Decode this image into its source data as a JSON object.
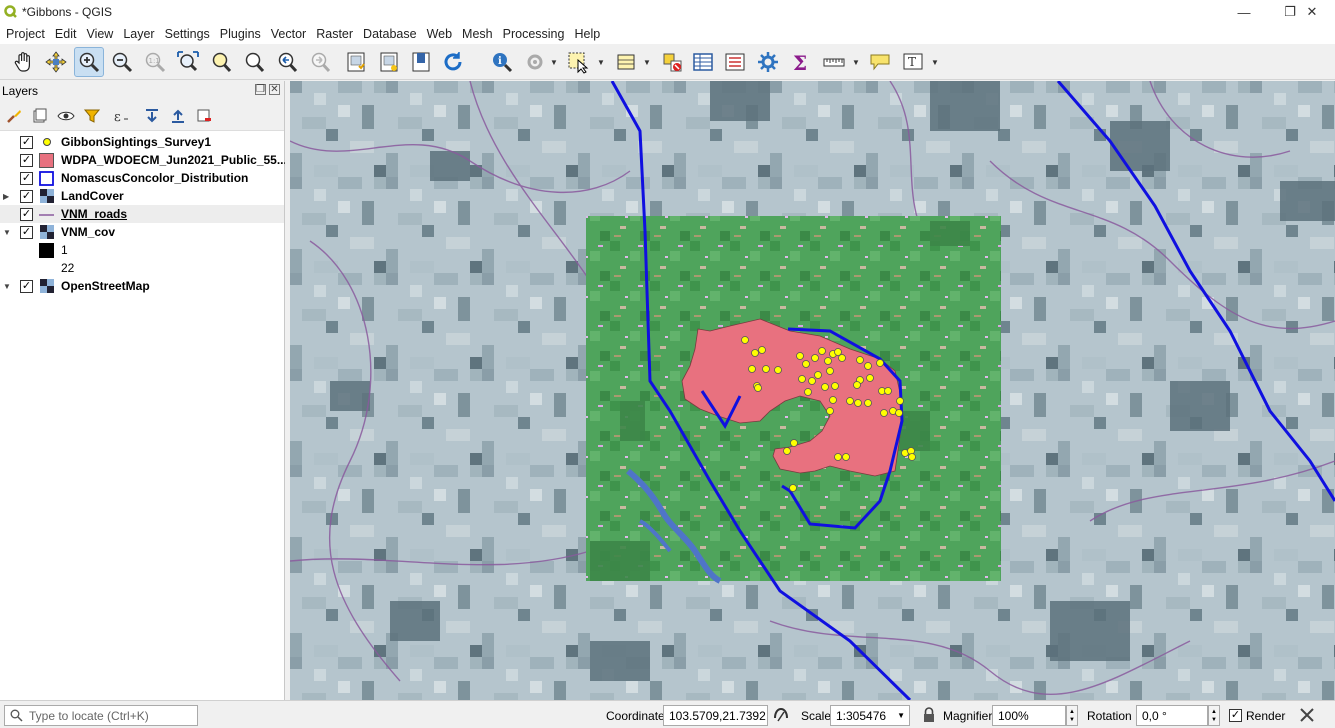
{
  "window": {
    "title": "*Gibbons - QGIS",
    "controls": [
      "minimize-icon",
      "restore-icon",
      "close-icon"
    ]
  },
  "menu": [
    "Project",
    "Edit",
    "View",
    "Layer",
    "Settings",
    "Plugins",
    "Vector",
    "Raster",
    "Database",
    "Web",
    "Mesh",
    "Processing",
    "Help"
  ],
  "toolbar": {
    "active_tool": "zoom-in-icon",
    "icons": [
      "pan-hand-icon",
      "pan-to-selection-icon",
      "zoom-in-icon",
      "zoom-out-icon",
      "zoom-native-icon",
      "zoom-full-icon",
      "zoom-to-selection-icon",
      "zoom-to-layer-icon",
      "zoom-last-icon",
      "zoom-next-icon",
      "new-bookmark-icon",
      "show-bookmarks-icon",
      "new-map-view-icon",
      "refresh-icon",
      "identify-icon",
      "action-icon",
      "select-features-icon",
      "select-by-value-icon",
      "deselect-icon",
      "attribute-table-icon",
      "field-calculator-icon",
      "toolbox-icon",
      "statistics-sigma-icon",
      "measure-icon",
      "map-tips-icon",
      "text-annotation-icon"
    ]
  },
  "layers_panel": {
    "title": "Layers",
    "items": [
      {
        "name": "GibbonSightings_Survey1",
        "checked": true,
        "symbol": "yellow-point-icon",
        "bold": true,
        "expander": ""
      },
      {
        "name": "WDPA_WDOECM_Jun2021_Public_55...",
        "checked": true,
        "symbol": "pink-polygon-icon",
        "bold": true,
        "expander": ""
      },
      {
        "name": "NomascusConcolor_Distribution",
        "checked": true,
        "symbol": "blue-outline-polygon-icon",
        "bold": true,
        "expander": ""
      },
      {
        "name": "LandCover",
        "checked": true,
        "symbol": "raster-icon",
        "bold": true,
        "expander": "collapsed"
      },
      {
        "name": "VNM_roads",
        "checked": true,
        "symbol": "purple-line-icon",
        "bold": true,
        "expander": "",
        "selected": true
      },
      {
        "name": "VNM_cov",
        "checked": true,
        "symbol": "raster-icon",
        "bold": true,
        "expander": "expanded"
      },
      {
        "name": "1",
        "checked": null,
        "symbol": "black-swatch-icon",
        "bold": false,
        "expander": ""
      },
      {
        "name": "22",
        "checked": null,
        "symbol": "",
        "bold": false,
        "expander": ""
      },
      {
        "name": "OpenStreetMap",
        "checked": true,
        "symbol": "raster-icon",
        "bold": true,
        "expander": "expanded"
      }
    ]
  },
  "status": {
    "locate_placeholder": "Type to locate (Ctrl+K)",
    "coordinate_label": "Coordinate",
    "coordinate_value": "103.5709,21.7392",
    "scale_label": "Scale",
    "scale_value": "1:305476",
    "magnifier_label": "Magnifier",
    "magnifier_value": "100%",
    "rotation_label": "Rotation",
    "rotation_value": "0,0 °",
    "render_label": "Render",
    "render_checked": true
  },
  "colors": {
    "protected_area": "#e8717f",
    "distribution_outline": "#1010e0",
    "sightings": "#ffff00",
    "roads": "#8a5a9e",
    "landcover": "#4da65a"
  }
}
